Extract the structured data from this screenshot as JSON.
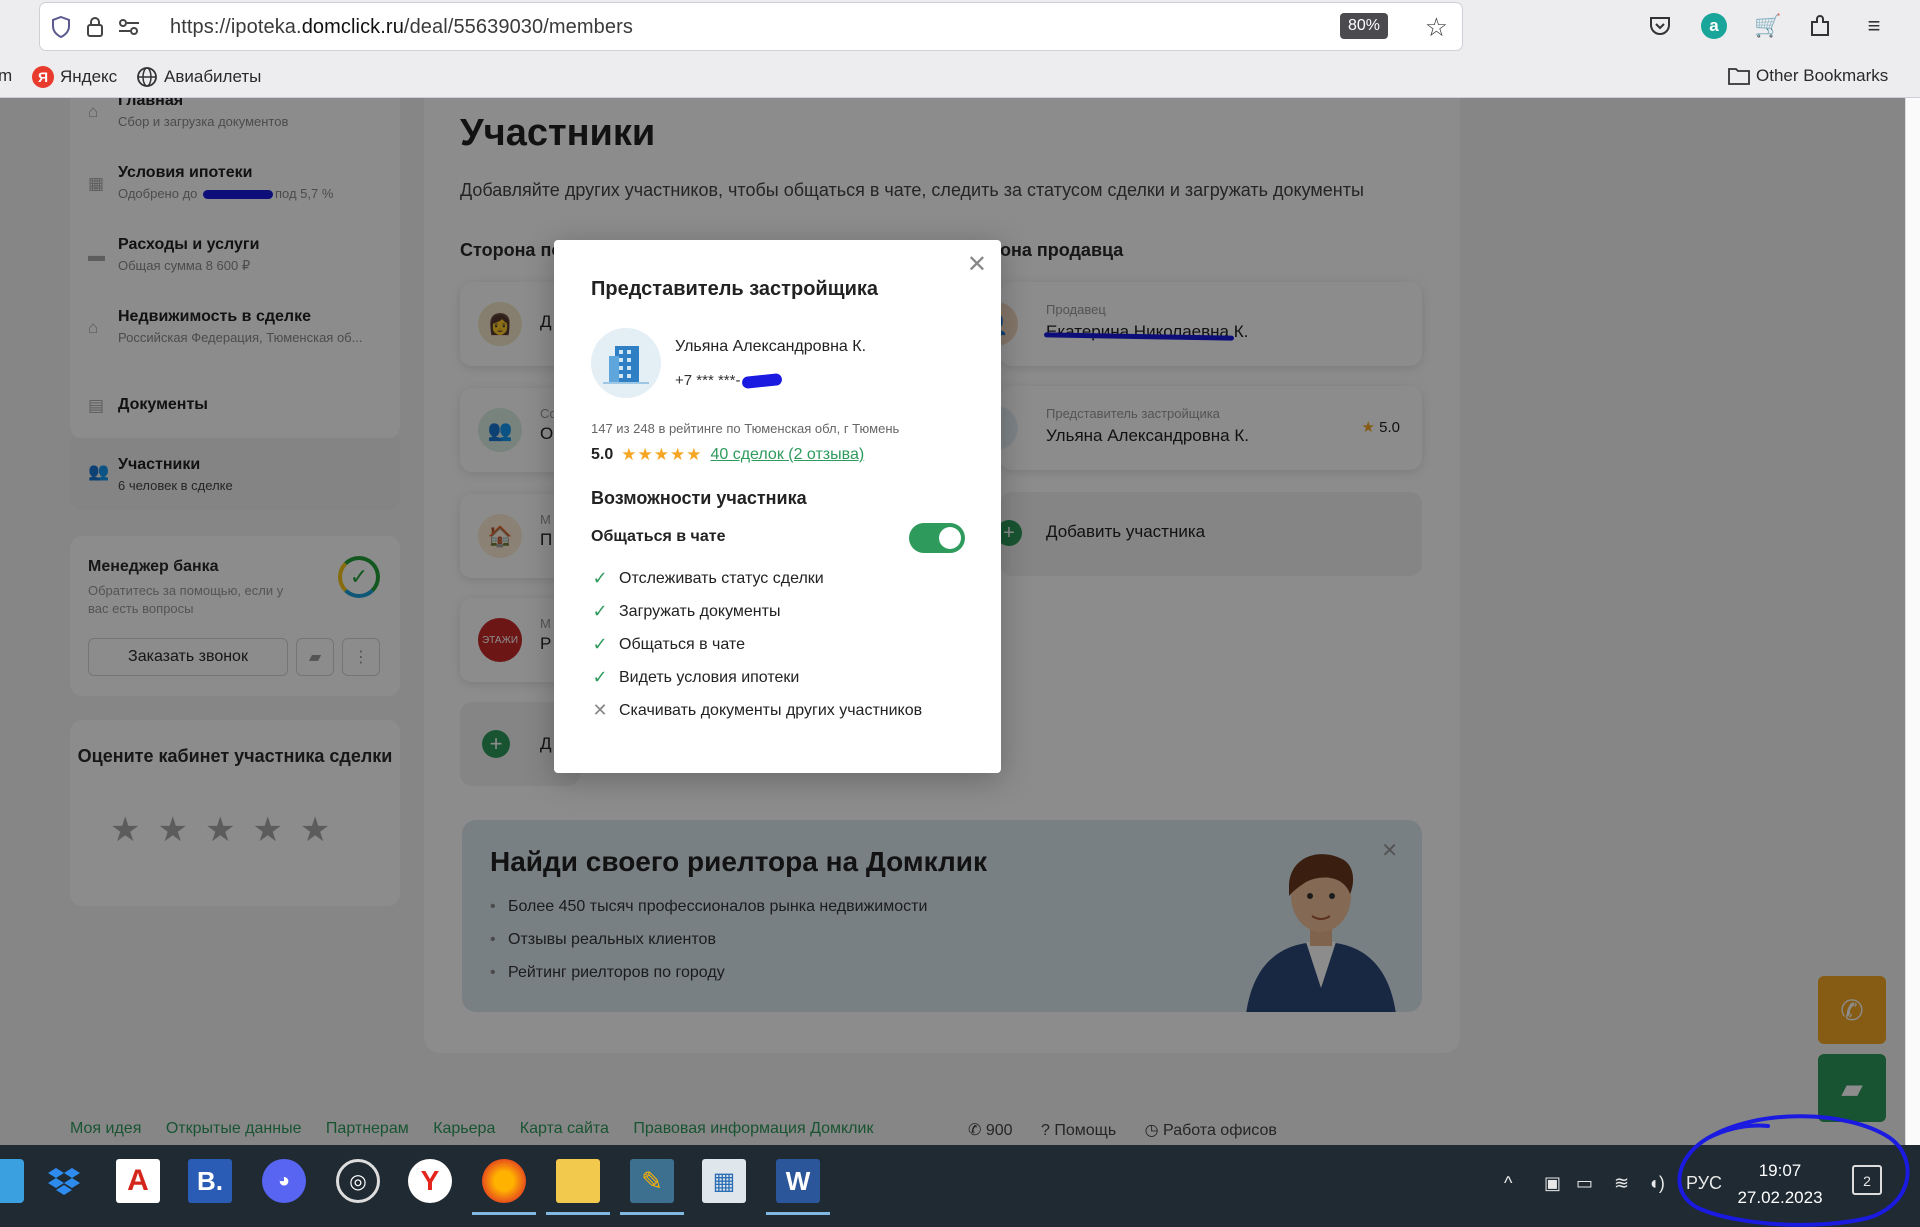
{
  "browser": {
    "url_prefix": "https://ipoteka.",
    "url_domain": "domclick.ru",
    "url_path": "/deal/55639030/members",
    "zoom": "80%",
    "bookmarks": [
      {
        "label": "m"
      },
      {
        "label": "Яндекс",
        "icon": "yandex-icon"
      },
      {
        "label": "Авиабилеты",
        "icon": "globe-icon"
      }
    ],
    "other_bookmarks": "Other Bookmarks"
  },
  "sidebar": {
    "items": [
      {
        "title": "Главная",
        "subtitle": "Сбор и загрузка документов",
        "icon": "home-icon"
      },
      {
        "title": "Условия ипотеки",
        "subtitle": "Одобрено до ",
        "subtitle_tail": "под 5,7 %",
        "icon": "calculator-icon"
      },
      {
        "title": "Расходы и услуги",
        "subtitle": "Общая сумма 8 600 ₽",
        "icon": "wallet-icon"
      },
      {
        "title": "Недвижимость в сделке",
        "subtitle": "Российская Федерация, Тюменская об...",
        "icon": "house-icon"
      },
      {
        "title": "Документы",
        "subtitle": "",
        "icon": "document-icon"
      },
      {
        "title": "Участники",
        "subtitle": "6 человек в сделке",
        "icon": "people-icon"
      }
    ],
    "manager": {
      "title": "Менеджер банка",
      "subtitle": "Обратитесь за помощью, если у вас есть вопросы",
      "call_button": "Заказать звонок"
    },
    "rate": {
      "title": "Оцените кабинет участника сделки",
      "stars": "★★★★★"
    }
  },
  "main": {
    "title": "Участники",
    "lead": "Добавляйте других участников, чтобы общаться в чате, следить за статусом сделки и загружать документы",
    "buyer_side": "Сторона по",
    "seller_side": "она продавца",
    "buyer_cards": [
      {
        "label": "",
        "name": "Д",
        "avatar": "person-avatar"
      },
      {
        "label": "Со",
        "name": "О",
        "avatar": "people-avatar"
      },
      {
        "label": "М",
        "name": "П",
        "avatar": "agency-avatar"
      },
      {
        "label": "М",
        "name": "Р",
        "avatar": "etazhi-avatar"
      }
    ],
    "buyer_add": "Д",
    "seller_cards": [
      {
        "label": "Продавец",
        "name": "Екатерина Николаевна К.",
        "rating": ""
      },
      {
        "label": "Представитель застройщика",
        "name": "Ульяна Александровна К.",
        "rating": "5.0"
      }
    ],
    "add_member": "Добавить участника",
    "banner": {
      "title": "Найди своего риелтора на Домклик",
      "items": [
        "Более 450 тысяч профессионалов рынка недвижимости",
        "Отзывы реальных клиентов",
        "Рейтинг риелторов по городу"
      ]
    }
  },
  "footer": {
    "links": [
      "Моя идея",
      "Открытые данные",
      "Партнерам",
      "Карьера",
      "Карта сайта",
      "Правовая информация Домклик"
    ],
    "phone": "900",
    "help": "Помощь",
    "offices": "Работа офисов"
  },
  "modal": {
    "title": "Представитель застройщика",
    "name": "Ульяна Александровна К.",
    "phone": "+7 *** ***-",
    "rank": "147 из 248 в рейтинге по Тюменская обл, г Тюмень",
    "score": "5.0",
    "stars": "★★★★★",
    "deals_link": "40 сделок (2 отзыва)",
    "abilities_title": "Возможности участника",
    "chat_label": "Общаться в чате",
    "chat_enabled": true,
    "permissions": [
      {
        "label": "Отслеживать статус сделки",
        "allowed": true
      },
      {
        "label": "Загружать документы",
        "allowed": true
      },
      {
        "label": "Общаться в чате",
        "allowed": true
      },
      {
        "label": "Видеть условия ипотеки",
        "allowed": true
      },
      {
        "label": "Скачивать документы других участников",
        "allowed": false
      }
    ]
  },
  "taskbar": {
    "apps": [
      "dropbox-icon",
      "acrobat-icon",
      "b-app-icon",
      "discord-icon",
      "obs-icon",
      "yandex-browser-icon",
      "firefox-icon",
      "file-explorer-icon",
      "paint-icon",
      "calculator-icon",
      "word-icon"
    ],
    "language": "РУС",
    "time": "19:07",
    "date": "27.02.2023",
    "notifications": "2"
  },
  "colors": {
    "accent": "#2e9a5c",
    "star": "#f5a623",
    "annotation": "#1a1ae0",
    "taskbar": "#1f2a32"
  }
}
